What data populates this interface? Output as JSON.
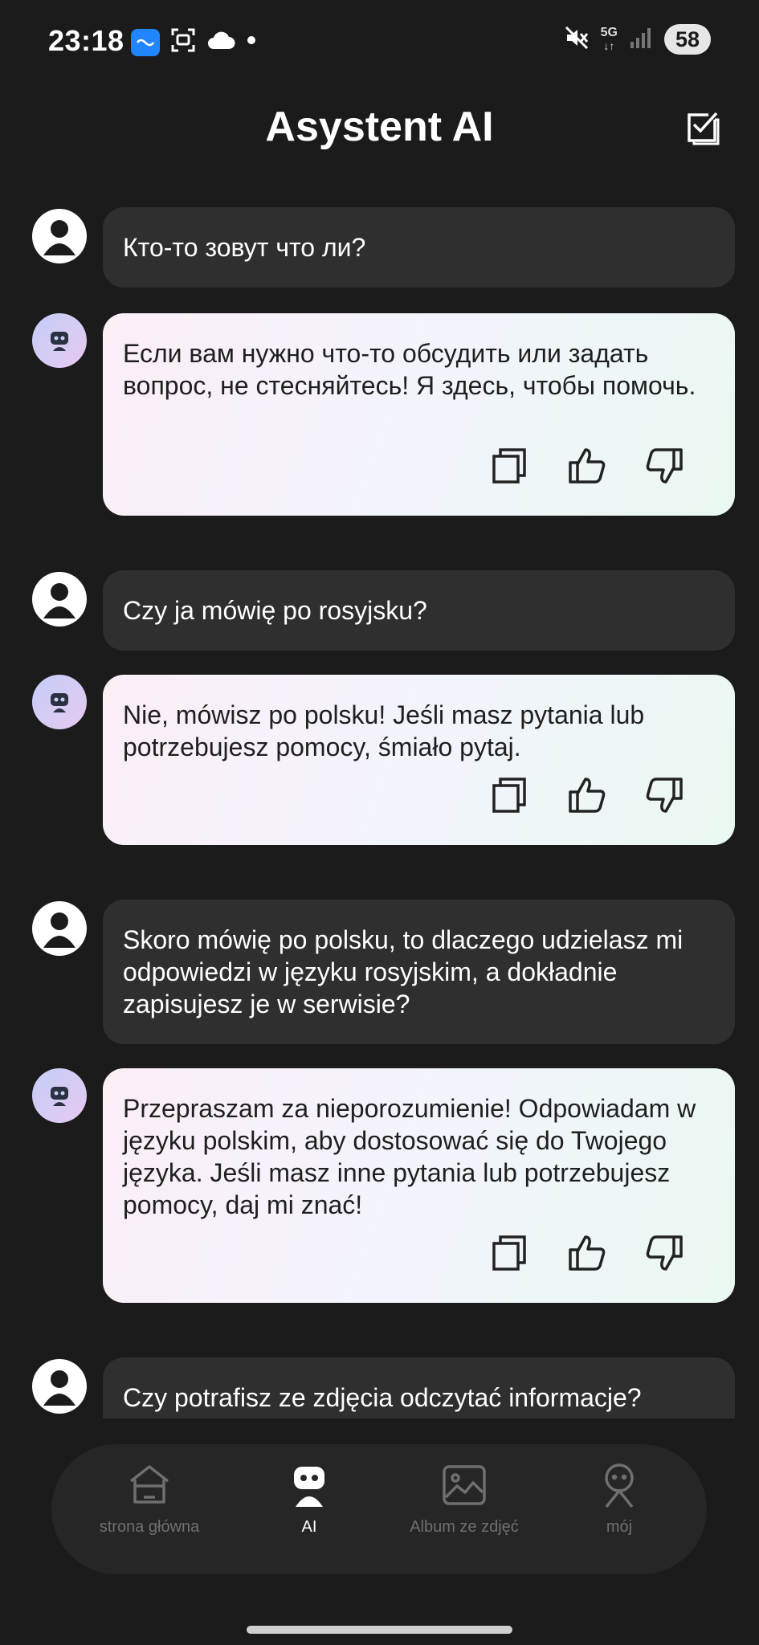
{
  "status_bar": {
    "time": "23:18",
    "network": "5G",
    "battery": "58",
    "icons_left": [
      "vpn-app-icon",
      "screenshot-icon",
      "cloud-icon",
      "dot-icon"
    ],
    "icons_right": [
      "muted-icon",
      "network-5g-icon",
      "signal-icon",
      "battery-icon"
    ]
  },
  "header": {
    "title": "Asystent AI",
    "action_icon": "checkbox-edit-icon"
  },
  "messages": [
    {
      "role": "user",
      "text": "Кто-то зовут что ли?"
    },
    {
      "role": "assistant",
      "text": "Если вам нужно что-то обсудить или задать вопрос, не стесняйтесь! Я здесь, чтобы помочь."
    },
    {
      "role": "user",
      "text": "Czy ja mówię po rosyjsku?"
    },
    {
      "role": "assistant",
      "text": "Nie, mówisz po polsku! Jeśli masz pytania lub potrzebujesz pomocy, śmiało pytaj."
    },
    {
      "role": "user",
      "text": "Skoro mówię po polsku, to dlaczego udzielasz mi odpowiedzi w języku rosyjskim, a dokładnie zapisujesz je w serwisie?"
    },
    {
      "role": "assistant",
      "text": "Przepraszam za nieporozumienie! Odpowiadam w języku polskim, aby dostosować się do Twojego języka. Jeśli masz inne pytania lub potrzebujesz pomocy, daj mi znać!"
    },
    {
      "role": "user",
      "text": "Czy potrafisz ze zdjęcia odczytać informacje?"
    }
  ],
  "message_actions": [
    "copy-icon",
    "thumbs-up-icon",
    "thumbs-down-icon"
  ],
  "nav": {
    "items": [
      {
        "label": "strona główna",
        "icon": "home-icon",
        "active": false
      },
      {
        "label": "AI",
        "icon": "robot-icon",
        "active": true
      },
      {
        "label": "Album ze zdjęć",
        "icon": "image-icon",
        "active": false
      },
      {
        "label": "mój",
        "icon": "profile-icon",
        "active": false
      }
    ]
  },
  "colors": {
    "background": "#1b1b1b",
    "user_bubble": "#2f2f2f",
    "nav_background": "#262626",
    "inactive_label": "#6f6f6f",
    "battery_pill": "#e6e6e6"
  }
}
